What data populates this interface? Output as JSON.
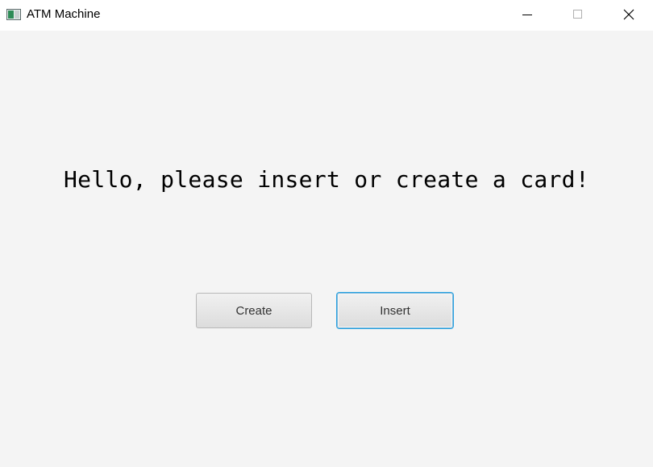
{
  "window": {
    "title": "ATM Machine",
    "icon": "app-window-icon",
    "controls": {
      "minimize_icon": "minimize-icon",
      "maximize_icon": "maximize-icon",
      "close_icon": "close-icon"
    }
  },
  "main": {
    "greeting": "Hello, please insert or create a card!",
    "buttons": {
      "create_label": "Create",
      "insert_label": "Insert"
    }
  },
  "colors": {
    "background": "#f4f4f4",
    "focus_ring": "#2aa3e2"
  }
}
